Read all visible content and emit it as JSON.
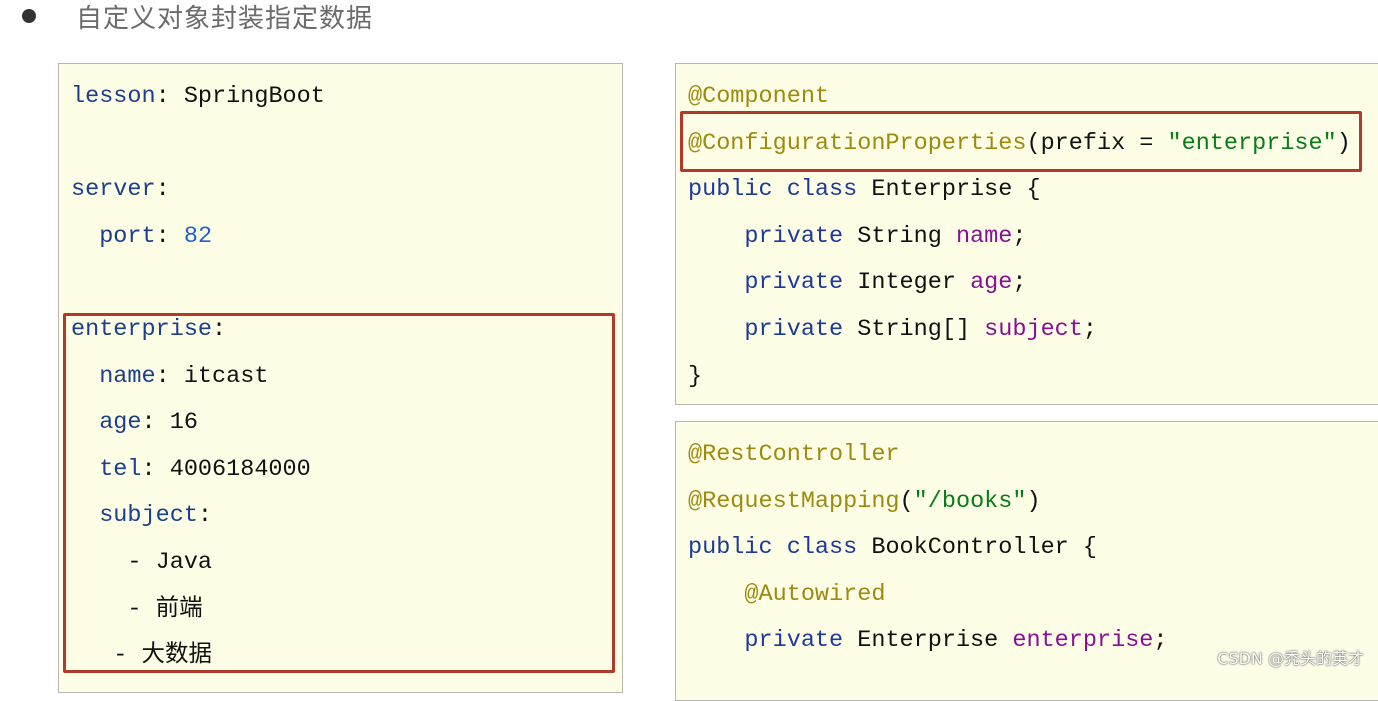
{
  "title": "自定义对象封装指定数据",
  "yaml_panel": {
    "lines": [
      [
        [
          "lesson",
          "key"
        ],
        [
          ": SpringBoot",
          "plain"
        ]
      ],
      [],
      [
        [
          "server",
          "key"
        ],
        [
          ":",
          "plain"
        ]
      ],
      [
        [
          "  port",
          "key"
        ],
        [
          ": ",
          "plain"
        ],
        [
          "82",
          "num"
        ]
      ],
      [],
      [
        [
          "enterprise",
          "key"
        ],
        [
          ":",
          "plain"
        ]
      ],
      [
        [
          "  name",
          "key"
        ],
        [
          ": itcast",
          "plain"
        ]
      ],
      [
        [
          "  age",
          "key"
        ],
        [
          ": 16",
          "plain"
        ]
      ],
      [
        [
          "  tel",
          "key"
        ],
        [
          ": 4006184000",
          "plain"
        ]
      ],
      [
        [
          "  subject",
          "key"
        ],
        [
          ":",
          "plain"
        ]
      ],
      [
        [
          "    - Java",
          "plain"
        ]
      ],
      [
        [
          "    - 前端",
          "plain"
        ]
      ],
      [
        [
          "   - 大数据",
          "plain"
        ]
      ]
    ]
  },
  "enterprise_panel": {
    "lines": [
      [
        [
          "@Component",
          "anno"
        ]
      ],
      [
        [
          "@ConfigurationProperties",
          "anno"
        ],
        [
          "(prefix = ",
          "plain"
        ],
        [
          "\"enterprise\"",
          "str"
        ],
        [
          ")",
          "plain"
        ]
      ],
      [
        [
          "public class ",
          "kw"
        ],
        [
          "Enterprise {",
          "plain"
        ]
      ],
      [
        [
          "    private ",
          "kw"
        ],
        [
          "String ",
          "plain"
        ],
        [
          "name",
          "field"
        ],
        [
          ";",
          "plain"
        ]
      ],
      [
        [
          "    private ",
          "kw"
        ],
        [
          "Integer ",
          "plain"
        ],
        [
          "age",
          "field"
        ],
        [
          ";",
          "plain"
        ]
      ],
      [
        [
          "    private ",
          "kw"
        ],
        [
          "String[] ",
          "plain"
        ],
        [
          "subject",
          "field"
        ],
        [
          ";",
          "plain"
        ]
      ],
      [
        [
          "}",
          "plain"
        ]
      ]
    ]
  },
  "controller_panel": {
    "lines": [
      [
        [
          "@RestController",
          "anno"
        ]
      ],
      [
        [
          "@RequestMapping",
          "anno"
        ],
        [
          "(",
          "plain"
        ],
        [
          "\"/books\"",
          "str"
        ],
        [
          ")",
          "plain"
        ]
      ],
      [
        [
          "public class ",
          "kw"
        ],
        [
          "BookController {",
          "plain"
        ]
      ],
      [
        [
          "    @Autowired",
          "anno"
        ]
      ],
      [
        [
          "    private ",
          "kw"
        ],
        [
          "Enterprise ",
          "plain"
        ],
        [
          "enterprise",
          "field"
        ],
        [
          ";",
          "plain"
        ]
      ]
    ]
  },
  "watermark": "CSDN @秃头的英才",
  "colors": {
    "highlight_box": "#b23a2a",
    "panel_bg": "#fefee6"
  }
}
